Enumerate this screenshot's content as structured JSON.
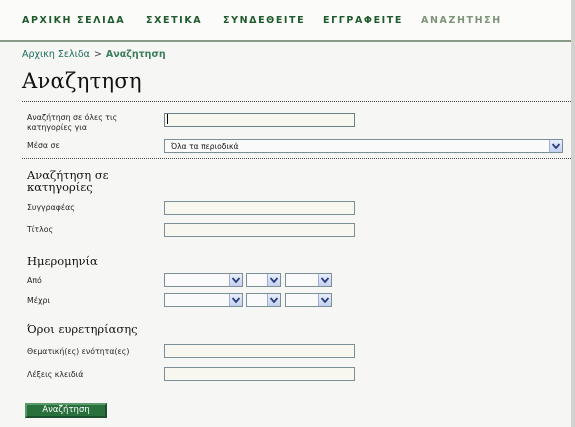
{
  "nav": {
    "items": [
      {
        "label": "ΑΡΧΙΚΗ ΣΕΛΙΔΑ"
      },
      {
        "label": "ΣΧΕΤΙΚΑ"
      },
      {
        "label": "ΣΥΝΔΕΘΕΙΤΕ"
      },
      {
        "label": "ΕΓΓΡΑΦΕΙΤΕ"
      },
      {
        "label": "ΑΝΑΖΗΤΗΣΗ"
      }
    ],
    "active_index": 4
  },
  "breadcrumb": {
    "home": "Αρχικη Σελιδα",
    "separator": ">",
    "current": "Αναζητηση"
  },
  "page_title": "Αναζητηση",
  "form": {
    "search_all_label_line1": "Αναζήτηση σε όλες τις",
    "search_all_label_line2": "κατηγορίες για",
    "search_all_value": "",
    "within_label": "Μέσα σε",
    "within_selected": "Όλα τα περιοδικά",
    "categories_heading_line1": "Αναζήτηση σε",
    "categories_heading_line2": "κατηγορίες",
    "author_label": "Συγγραφέας",
    "author_value": "",
    "title_label": "Τίτλος",
    "title_value": "",
    "date_heading": "Ημερομηνία",
    "from_label": "Από",
    "to_label": "Μέχρι",
    "from_month": "",
    "from_day": "",
    "from_year": "",
    "to_month": "",
    "to_day": "",
    "to_year": "",
    "index_terms_heading": "Όροι ευρετηρίασης",
    "subjects_label": "Θεματική(ες) ενότητα(ες)",
    "subjects_value": "",
    "keywords_label": "Λέξεις κλειδιά",
    "keywords_value": "",
    "submit_label": "Αναζήτηση"
  },
  "colors": {
    "accent": "#29703d",
    "nav_text": "#1d5a2c",
    "nav_active": "#7d9379"
  },
  "icons": {
    "dropdown": "chevron-down-icon"
  }
}
